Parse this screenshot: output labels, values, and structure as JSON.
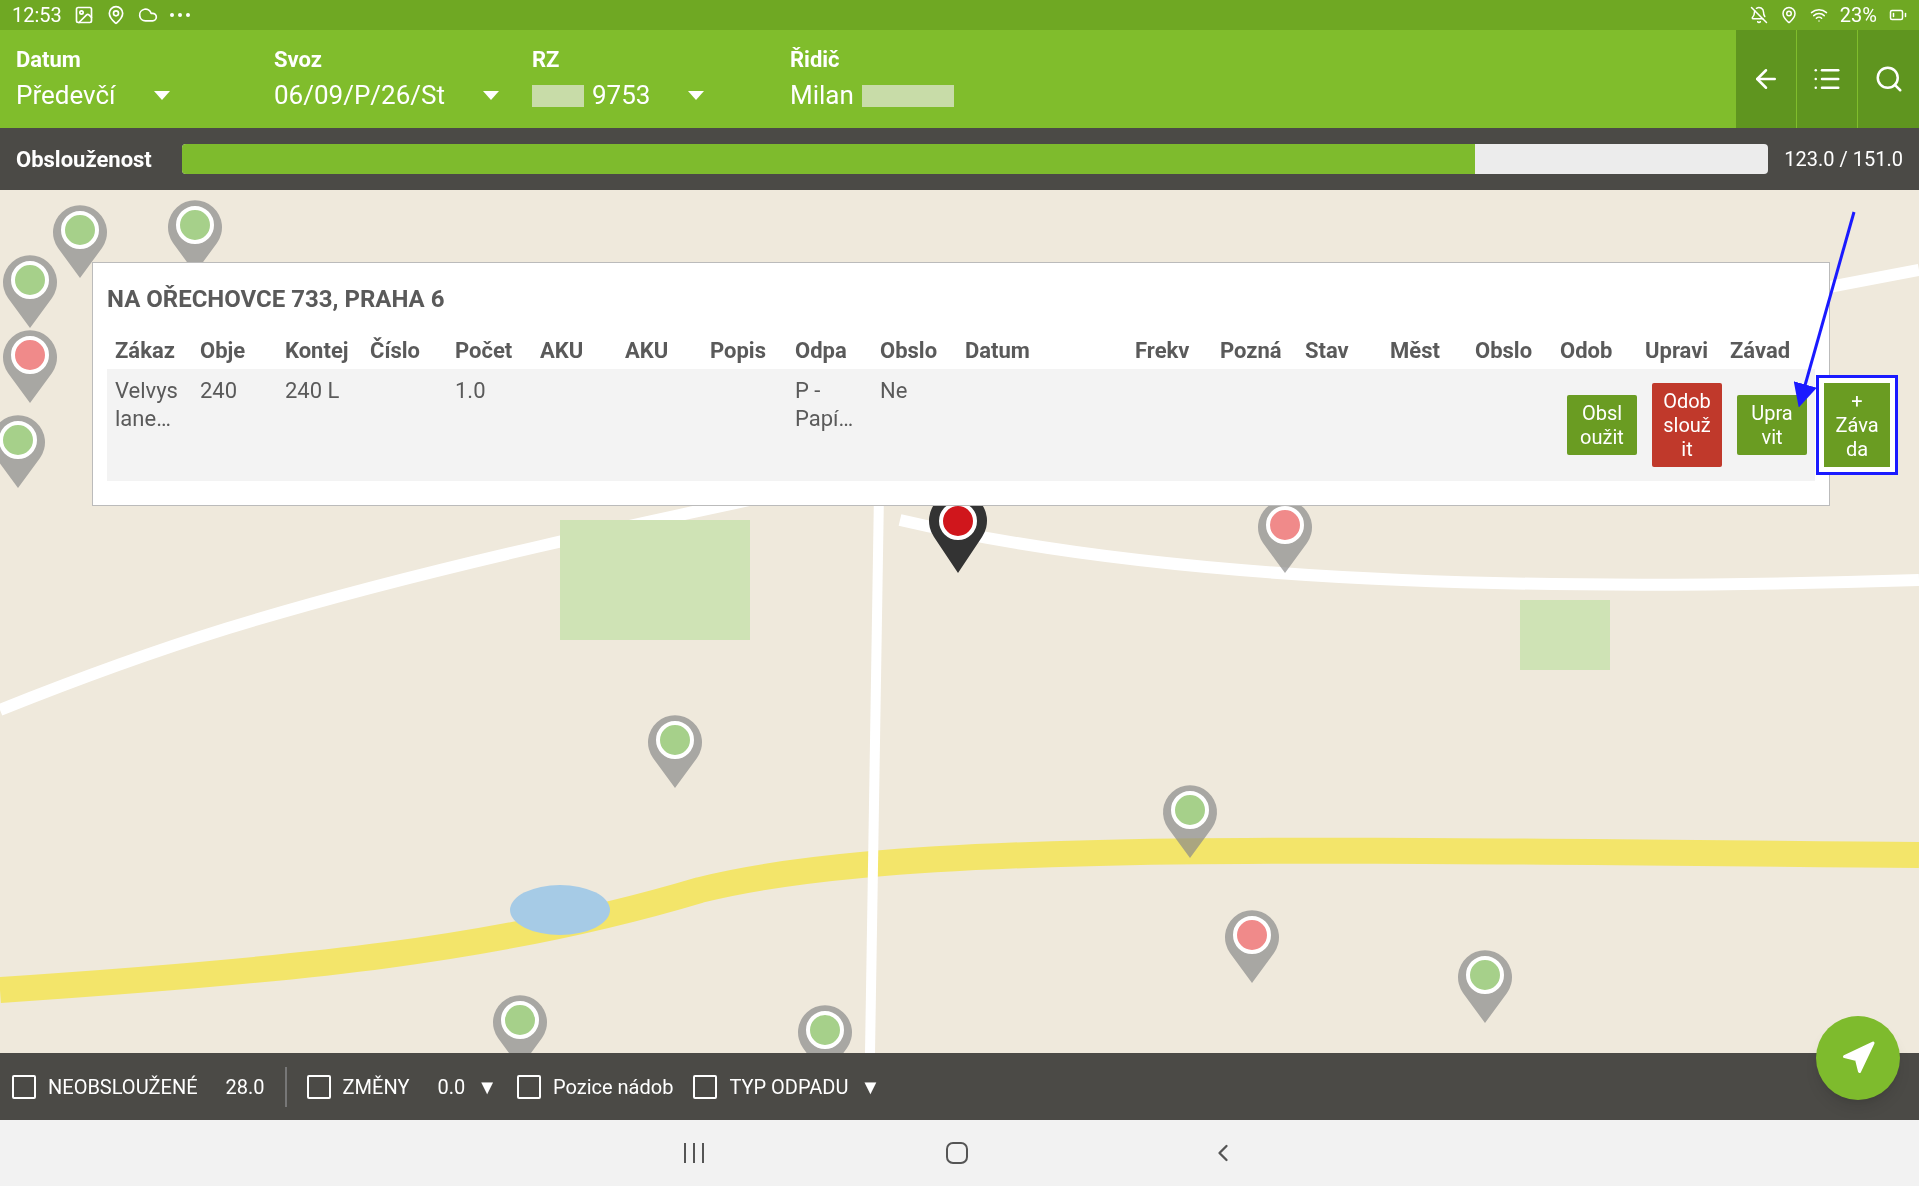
{
  "status_bar": {
    "time": "12:53",
    "battery": "23%"
  },
  "header": {
    "fields": [
      {
        "label": "Datum",
        "parts": [
          {
            "kind": "text",
            "text": "Předevčí"
          }
        ]
      },
      {
        "label": "Svoz",
        "parts": [
          {
            "kind": "text",
            "text": "06/09/P/26/St"
          }
        ]
      },
      {
        "label": "RZ",
        "parts": [
          {
            "kind": "blurred"
          },
          {
            "kind": "text",
            "text": "9753"
          }
        ]
      },
      {
        "label": "Řidič",
        "parts": [
          {
            "kind": "text",
            "text": "Milan"
          },
          {
            "kind": "blurred"
          }
        ]
      }
    ]
  },
  "progress": {
    "label": "Obslouženost",
    "level": 0.815,
    "reading": "123.0 / 151.0"
  },
  "popup": {
    "title": "NA OŘECHOVCE 733, PRAHA 6",
    "columns": [
      "Zákaz",
      "Obje",
      "Kontej",
      "Číslo",
      "Počet",
      "AKU",
      "AKU",
      "Popis",
      "Odpa",
      "Obslo",
      "Datum",
      "Frekv",
      "Pozná",
      "Stav",
      "Měst",
      "Obslo",
      "Odob",
      "Upravi",
      "Závad"
    ],
    "row": {
      "cells": [
        "Velvys lane…",
        "240",
        "240 L",
        "",
        "1.0",
        "",
        "",
        "",
        "P - Papí…",
        "Ne",
        "",
        "",
        "",
        "",
        "",
        ""
      ],
      "buttons": [
        {
          "label": "Obsl oužit",
          "kind": "confirm",
          "highlighted": false
        },
        {
          "label": "Odob slouž it",
          "kind": "danger",
          "highlighted": false
        },
        {
          "label": "Upra vit",
          "kind": "confirm",
          "highlighted": false
        },
        {
          "label": "+ Záva da",
          "kind": "confirm",
          "highlighted": true
        }
      ]
    }
  },
  "filters": [
    {
      "label": "NEOBSLOUŽENÉ",
      "checked": false,
      "value": "28.0"
    },
    {
      "label": "ZMĚNY",
      "checked": false,
      "value": "0.0",
      "caret": "▼"
    },
    {
      "label": "Pozice nádob",
      "checked": false
    },
    {
      "label": "TYP ODPADU",
      "checked": false,
      "caret": "▼"
    }
  ]
}
